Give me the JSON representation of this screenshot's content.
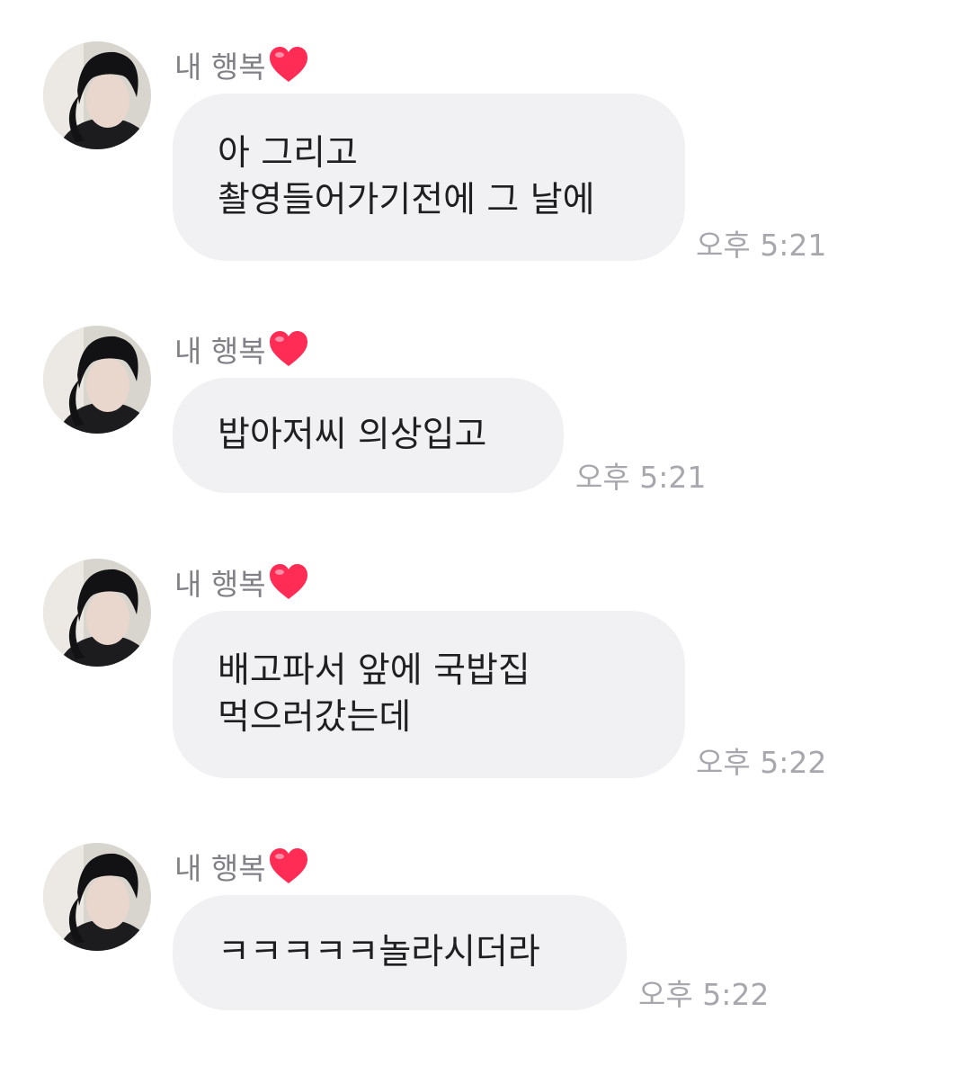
{
  "messages": [
    {
      "sender": "내 행복",
      "text": "아 그리고\n촬영들어가기전에 그 날에",
      "time": "오후 5:21",
      "avatar_icon": "profile-avatar",
      "emoji_icon": "heart-icon"
    },
    {
      "sender": "내 행복",
      "text": "밥아저씨 의상입고",
      "time": "오후 5:21",
      "avatar_icon": "profile-avatar",
      "emoji_icon": "heart-icon"
    },
    {
      "sender": "내 행복",
      "text": "배고파서 앞에 국밥집\n먹으러갔는데",
      "time": "오후 5:22",
      "avatar_icon": "profile-avatar",
      "emoji_icon": "heart-icon"
    },
    {
      "sender": "내 행복",
      "text": "ㅋㅋㅋㅋㅋ놀라시더라",
      "time": "오후 5:22",
      "avatar_icon": "profile-avatar",
      "emoji_icon": "heart-icon"
    }
  ],
  "colors": {
    "bubble_bg": "#f1f1f4",
    "heart": "#ff2d55",
    "sender_text": "#808086",
    "time_text": "#a7a7ad"
  }
}
